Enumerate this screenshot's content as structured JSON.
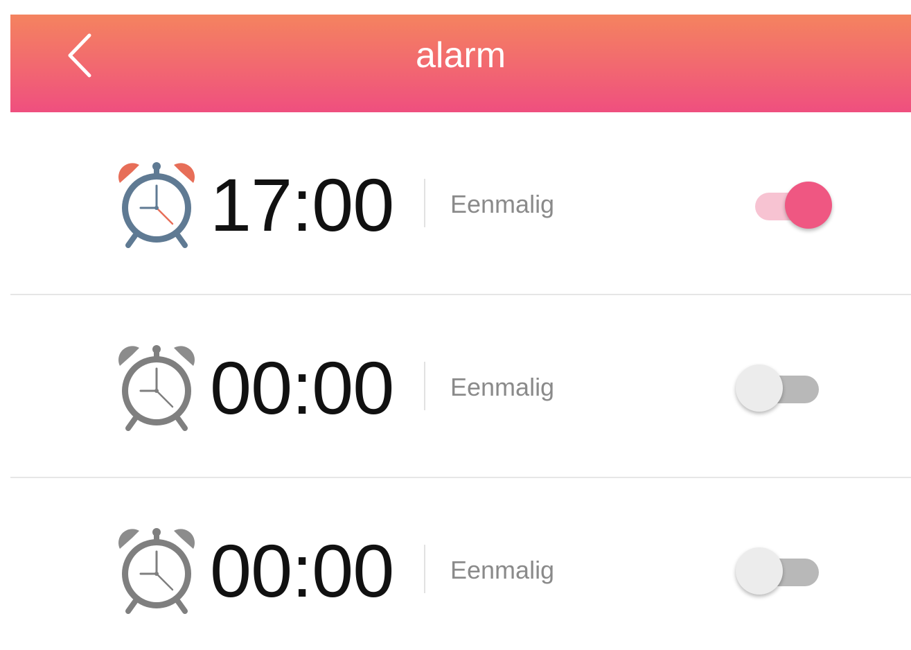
{
  "header": {
    "title": "alarm",
    "back_icon": "chevron-left-icon",
    "gradient_colors": [
      "#f4835f",
      "#ef4f7f"
    ]
  },
  "alarms": [
    {
      "time": "17:00",
      "repeat": "Eenmalig",
      "enabled": true,
      "icon": "alarm-clock-icon",
      "icon_color": "#5f7a93",
      "bell_color": "#e76e58"
    },
    {
      "time": "00:00",
      "repeat": "Eenmalig",
      "enabled": false,
      "icon": "alarm-clock-icon",
      "icon_color": "#7f7f7f",
      "bell_color": "#8c8c8c"
    },
    {
      "time": "00:00",
      "repeat": "Eenmalig",
      "enabled": false,
      "icon": "alarm-clock-icon",
      "icon_color": "#7f7f7f",
      "bell_color": "#8c8c8c"
    }
  ],
  "colors": {
    "accent": "#ef5782",
    "toggle_on_track": "#f7c3d2",
    "toggle_off_track": "#b8b8b8",
    "toggle_off_knob": "#ececec"
  }
}
